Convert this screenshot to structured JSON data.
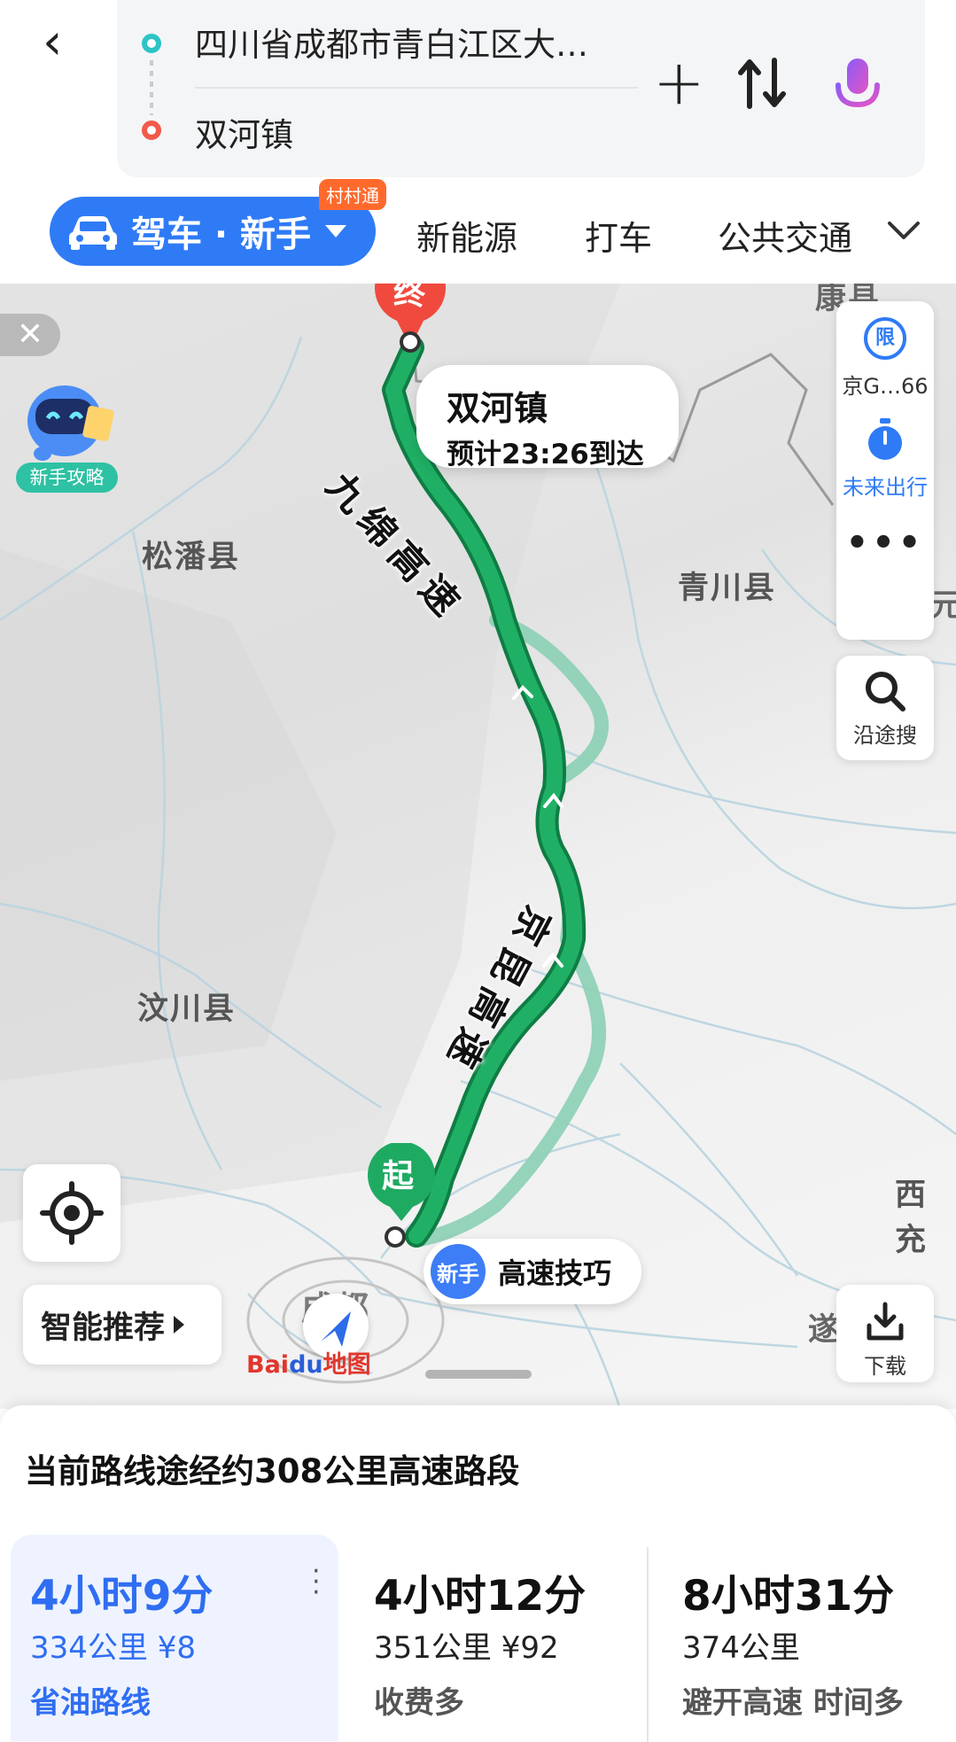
{
  "search": {
    "start": "四川省成都市青白江区大…",
    "end": "双河镇"
  },
  "tabs": {
    "drive_label": "驾车 · 新手",
    "badge": "村村通",
    "new_energy": "新能源",
    "taxi": "打车",
    "public_transit": "公共交通"
  },
  "map": {
    "labels": {
      "songpan": "松潘县",
      "qingchuan": "青川县",
      "wenchuan": "汶川县",
      "xichong": "西充",
      "kang": "康县",
      "sui": "遂",
      "yuan": "元"
    },
    "roads": {
      "jiumian": "九绵高速",
      "jingkun": "京昆高速"
    },
    "destination": {
      "pin": "终",
      "name": "双河镇",
      "eta": "预计23:26到达"
    },
    "start_pin": "起",
    "newbie_tag": "新手",
    "newbie_tip": "高速技巧",
    "guide_label": "新手攻略",
    "limit_icon": "限",
    "limit_text": "京G…66",
    "future_trip": "未来出行",
    "search_along": "沿途搜",
    "smart_recommend": "智能推荐",
    "download": "下载",
    "logo_bai": "Bai",
    "logo_du": "du",
    "logo_map": "地图",
    "city_partial": "成都"
  },
  "panel": {
    "highway_note": "当前路线途经约308公里高速路段",
    "routes": [
      {
        "time": "4小时9分",
        "dist": "334公里 ¥8",
        "tag": "省油路线"
      },
      {
        "time": "4小时12分",
        "dist": "351公里 ¥92",
        "tag": "收费多"
      },
      {
        "time": "8小时31分",
        "dist": "374公里",
        "tag": "避开高速 时间多"
      }
    ]
  },
  "colors": {
    "accent": "#2f7bf6",
    "route_main": "#1faa62",
    "route_alt": "#8fd1b7",
    "end_pin": "#f04a3e",
    "start_pin": "#1faa62"
  }
}
